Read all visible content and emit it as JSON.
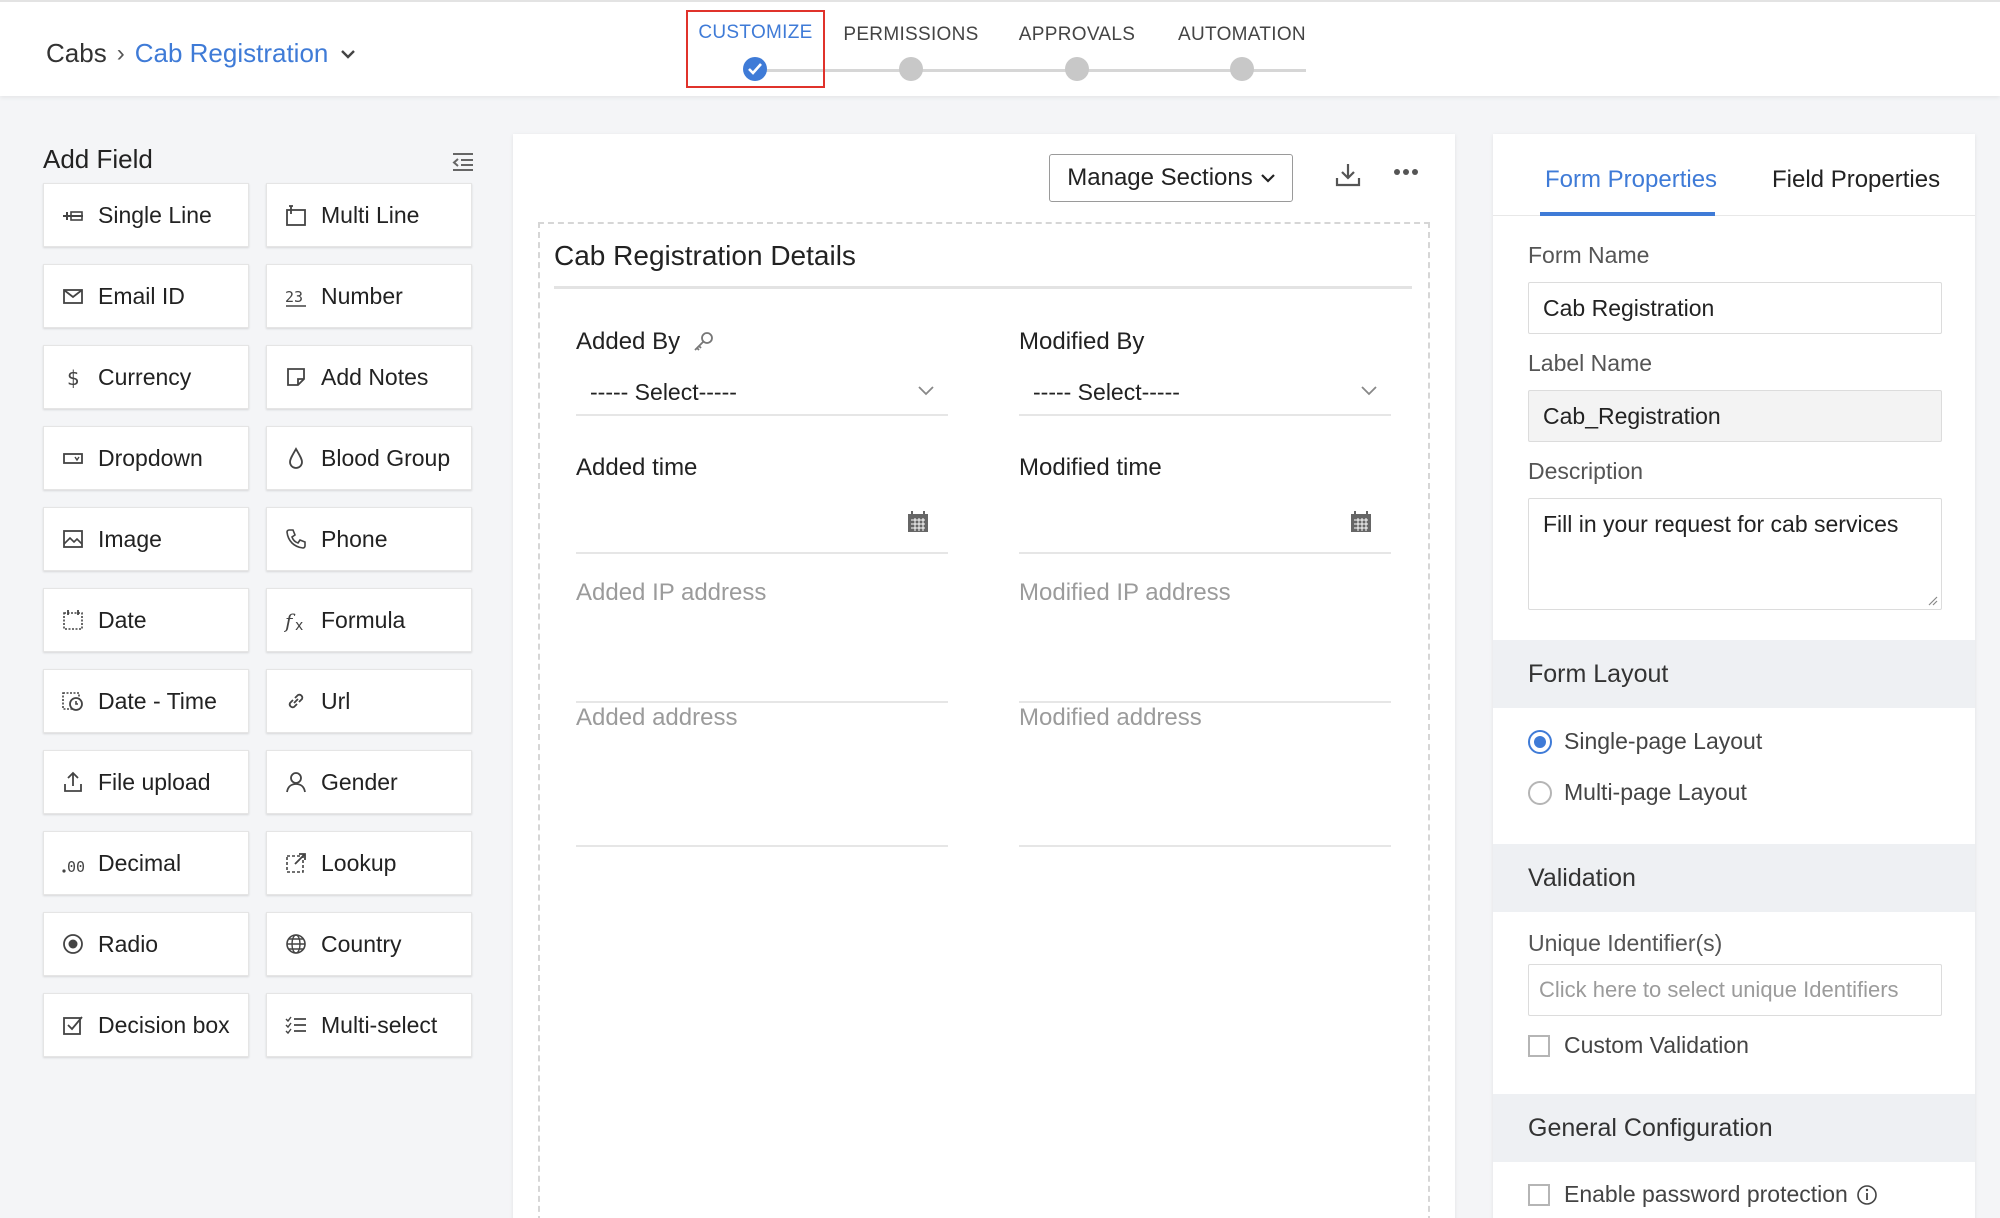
{
  "breadcrumb": {
    "root": "Cabs",
    "current": "Cab Registration"
  },
  "steps": [
    {
      "label": "CUSTOMIZE",
      "active": true
    },
    {
      "label": "PERMISSIONS",
      "active": false
    },
    {
      "label": "APPROVALS",
      "active": false
    },
    {
      "label": "AUTOMATION",
      "active": false
    }
  ],
  "add_field": {
    "title": "Add Field",
    "fields": [
      {
        "label": "Single Line",
        "icon": "single-line-icon"
      },
      {
        "label": "Multi Line",
        "icon": "multi-line-icon"
      },
      {
        "label": "Email ID",
        "icon": "email-icon"
      },
      {
        "label": "Number",
        "icon": "number-icon"
      },
      {
        "label": "Currency",
        "icon": "currency-icon"
      },
      {
        "label": "Add Notes",
        "icon": "notes-icon"
      },
      {
        "label": "Dropdown",
        "icon": "dropdown-icon"
      },
      {
        "label": "Blood Group",
        "icon": "blood-drop-icon"
      },
      {
        "label": "Image",
        "icon": "image-icon"
      },
      {
        "label": "Phone",
        "icon": "phone-icon"
      },
      {
        "label": "Date",
        "icon": "date-icon"
      },
      {
        "label": "Formula",
        "icon": "formula-icon"
      },
      {
        "label": "Date - Time",
        "icon": "date-time-icon"
      },
      {
        "label": "Url",
        "icon": "link-icon"
      },
      {
        "label": "File upload",
        "icon": "upload-icon"
      },
      {
        "label": "Gender",
        "icon": "person-icon"
      },
      {
        "label": "Decimal",
        "icon": "decimal-icon"
      },
      {
        "label": "Lookup",
        "icon": "lookup-icon"
      },
      {
        "label": "Radio",
        "icon": "radio-icon"
      },
      {
        "label": "Country",
        "icon": "globe-icon"
      },
      {
        "label": "Decision box",
        "icon": "checkbox-icon"
      },
      {
        "label": "Multi-select",
        "icon": "multi-select-icon"
      }
    ]
  },
  "canvas": {
    "manage_sections": "Manage Sections",
    "section_title": "Cab Registration Details",
    "fields": {
      "added_by": {
        "label": "Added By",
        "value": "----- Select-----"
      },
      "modified_by": {
        "label": "Modified By",
        "value": "----- Select-----"
      },
      "added_time": {
        "label": "Added time"
      },
      "modified_time": {
        "label": "Modified time"
      },
      "added_ip": {
        "label": "Added IP address"
      },
      "modified_ip": {
        "label": "Modified IP address"
      },
      "added_address": {
        "label": "Added address"
      },
      "modified_address": {
        "label": "Modified address"
      }
    }
  },
  "properties": {
    "tabs": [
      "Form Properties",
      "Field Properties"
    ],
    "form_name_label": "Form Name",
    "form_name_value": "Cab Registration",
    "label_name_label": "Label Name",
    "label_name_value": "Cab_Registration",
    "description_label": "Description",
    "description_value": "Fill in your request for cab services",
    "form_layout": {
      "title": "Form Layout",
      "options": [
        "Single-page Layout",
        "Multi-page Layout"
      ],
      "selected": "Single-page Layout"
    },
    "validation": {
      "title": "Validation",
      "unique_label": "Unique Identifier(s)",
      "unique_placeholder": "Click here to select unique Identifiers",
      "custom_validation": "Custom Validation"
    },
    "general": {
      "title": "General Configuration",
      "password_protection": "Enable password protection"
    }
  },
  "colors": {
    "accent": "#3f7bd7",
    "highlight": "#e0322b"
  }
}
